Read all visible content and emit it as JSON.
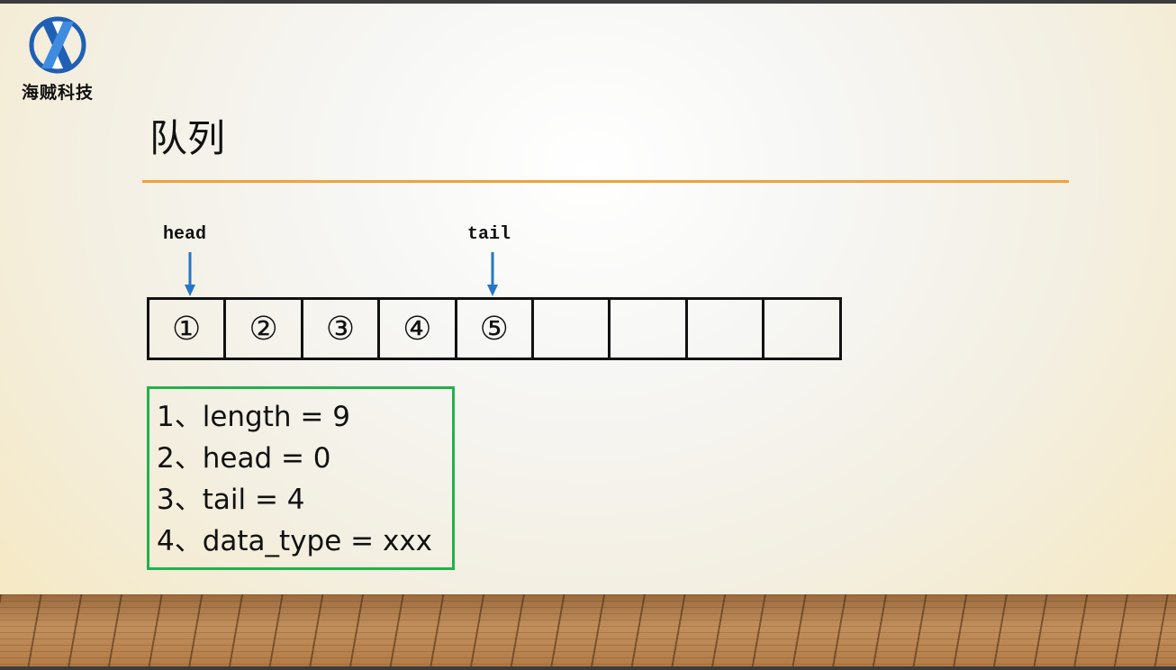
{
  "logo": {
    "company_name": "海贼科技"
  },
  "slide": {
    "title": "队列"
  },
  "pointers": {
    "head_label": "head",
    "tail_label": "tail"
  },
  "queue": {
    "cells": [
      "①",
      "②",
      "③",
      "④",
      "⑤",
      "",
      "",
      "",
      ""
    ],
    "head_index": 0,
    "tail_index": 4
  },
  "info": {
    "lines": [
      "1、length = 9",
      "2、head = 0",
      "3、tail = 4",
      "4、data_type = xxx"
    ]
  },
  "colors": {
    "accent_rule": "#f0a239",
    "box_border": "#22b14c",
    "arrow": "#2576c8",
    "logo_blue": "#1f5fb4"
  }
}
